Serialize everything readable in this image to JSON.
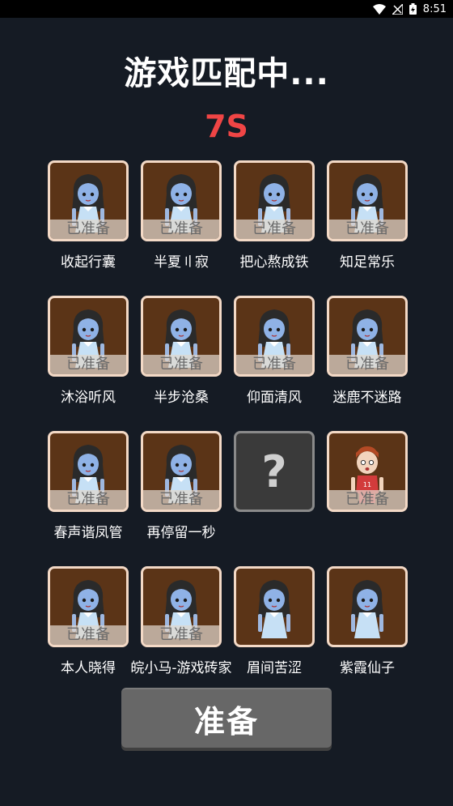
{
  "status": {
    "time": "8:51"
  },
  "title": "游戏匹配中...",
  "countdown": "7S",
  "ready_badge": "已准备",
  "empty_slot_symbol": "?",
  "players": [
    {
      "name": "收起行囊",
      "ready": true,
      "avatar": "girl"
    },
    {
      "name": "半夏〢寂",
      "ready": true,
      "avatar": "girl"
    },
    {
      "name": "把心熬成铁",
      "ready": true,
      "avatar": "girl"
    },
    {
      "name": "知足常乐",
      "ready": true,
      "avatar": "girl"
    },
    {
      "name": "沐浴听风",
      "ready": true,
      "avatar": "girl"
    },
    {
      "name": "半步沧桑",
      "ready": true,
      "avatar": "girl"
    },
    {
      "name": "仰面清风",
      "ready": true,
      "avatar": "girl"
    },
    {
      "name": "迷鹿不迷路",
      "ready": true,
      "avatar": "girl"
    },
    {
      "name": "春声谐凤管",
      "ready": true,
      "avatar": "girl"
    },
    {
      "name": "再停留一秒",
      "ready": true,
      "avatar": "girl"
    },
    {
      "name": "",
      "ready": false,
      "avatar": "empty"
    },
    {
      "name": "",
      "ready": true,
      "avatar": "boy"
    },
    {
      "name": "本人晓得",
      "ready": true,
      "avatar": "girl"
    },
    {
      "name": "皖小马-游戏砖家",
      "ready": true,
      "avatar": "girl"
    },
    {
      "name": "眉间苦涩",
      "ready": false,
      "avatar": "girl"
    },
    {
      "name": "紫霞仙子",
      "ready": false,
      "avatar": "girl"
    }
  ],
  "ready_button_label": "准备",
  "colors": {
    "background": "#151b24",
    "countdown": "#f04545",
    "card_bg": "#5b3417",
    "card_border": "#f3d9c6",
    "button": "#676767"
  }
}
